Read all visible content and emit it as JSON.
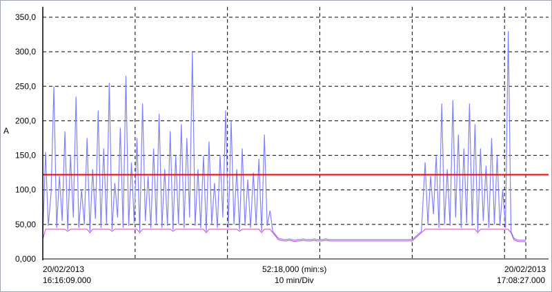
{
  "chart_data": {
    "type": "line",
    "ylabel": "A",
    "ylim": [
      0,
      350
    ],
    "yticks": [
      "0,000",
      "50,00",
      "100,0",
      "150,0",
      "200,0",
      "250,0",
      "300,0",
      "350,0"
    ],
    "grid": true,
    "grid_style": "dashed",
    "xlim_minutes": [
      0,
      52.3
    ],
    "x_divisions_minutes": 10,
    "threshold": {
      "value": 122,
      "color": "#ff0000"
    },
    "series": [
      {
        "color": "#8080ff",
        "x_minutes": [
          0.0,
          0.3,
          0.6,
          0.9,
          1.2,
          1.5,
          1.8,
          2.1,
          2.4,
          2.7,
          3.0,
          3.3,
          3.6,
          3.9,
          4.2,
          4.5,
          4.8,
          5.1,
          5.4,
          5.7,
          6.0,
          6.3,
          6.6,
          6.9,
          7.2,
          7.5,
          7.8,
          8.1,
          8.4,
          8.7,
          9.0,
          9.3,
          9.6,
          9.9,
          10.2,
          10.5,
          10.8,
          11.1,
          11.4,
          11.7,
          12.0,
          12.3,
          12.6,
          12.9,
          13.2,
          13.5,
          13.8,
          14.1,
          14.4,
          14.7,
          15.0,
          15.3,
          15.6,
          15.9,
          16.2,
          16.5,
          16.8,
          17.1,
          17.4,
          17.7,
          18.0,
          18.3,
          18.6,
          18.9,
          19.2,
          19.5,
          19.8,
          20.1,
          20.4,
          20.7,
          21.0,
          21.3,
          21.6,
          21.9,
          22.2,
          22.5,
          22.8,
          23.1,
          23.4,
          23.7,
          24.0,
          24.3,
          24.6,
          24.9,
          25.2,
          25.5,
          25.8,
          26.1,
          26.4,
          26.7,
          27.0,
          27.3,
          27.6,
          27.9,
          28.2,
          28.5,
          28.8,
          29.1,
          29.4,
          29.7,
          30.0,
          30.3,
          30.6,
          31.0,
          31.5,
          32.0,
          33.0,
          34.0,
          35.0,
          36.0,
          37.0,
          38.0,
          39.0,
          40.0,
          41.0,
          41.4,
          41.7,
          42.0,
          42.3,
          42.6,
          42.9,
          43.2,
          43.5,
          43.8,
          44.1,
          44.4,
          44.7,
          45.0,
          45.3,
          45.6,
          45.9,
          46.2,
          46.5,
          46.8,
          47.1,
          47.4,
          47.7,
          48.0,
          48.3,
          48.6,
          48.9,
          49.2,
          49.5,
          49.8,
          50.1,
          50.4,
          50.7,
          51.0,
          51.3,
          51.6,
          51.9,
          52.3
        ],
        "y": [
          30,
          155,
          48,
          95,
          250,
          45,
          120,
          55,
          185,
          42,
          150,
          60,
          235,
          45,
          100,
          50,
          175,
          40,
          130,
          58,
          215,
          45,
          160,
          50,
          255,
          42,
          110,
          60,
          190,
          45,
          265,
          48,
          140,
          52,
          175,
          40,
          225,
          55,
          120,
          45,
          160,
          50,
          210,
          45,
          130,
          48,
          185,
          42,
          150,
          50,
          195,
          45,
          175,
          60,
          300,
          48,
          130,
          45,
          150,
          40,
          170,
          50,
          110,
          45,
          150,
          60,
          215,
          45,
          200,
          50,
          130,
          42,
          160,
          48,
          115,
          45,
          125,
          50,
          145,
          40,
          180,
          48,
          70,
          40,
          35,
          30,
          29,
          28,
          28,
          29,
          28,
          27,
          28,
          28,
          29,
          28,
          28,
          28,
          29,
          28,
          28,
          28,
          29,
          28,
          28,
          28,
          28,
          28,
          28,
          28,
          28,
          28,
          28,
          28,
          40,
          140,
          50,
          120,
          65,
          150,
          45,
          225,
          50,
          130,
          48,
          230,
          60,
          180,
          45,
          160,
          52,
          225,
          48,
          195,
          40,
          160,
          55,
          135,
          45,
          175,
          50,
          150,
          48,
          100,
          45,
          330,
          40,
          30,
          28,
          27,
          27,
          27
        ]
      }
    ]
  },
  "x_footer": {
    "start_date": "20/02/2013",
    "start_time": "16:16:09.000",
    "span": "52:18,000 (min:s)",
    "scale": "10 min/Div",
    "end_date": "20/02/2013",
    "end_time": "17:08:27.000"
  }
}
